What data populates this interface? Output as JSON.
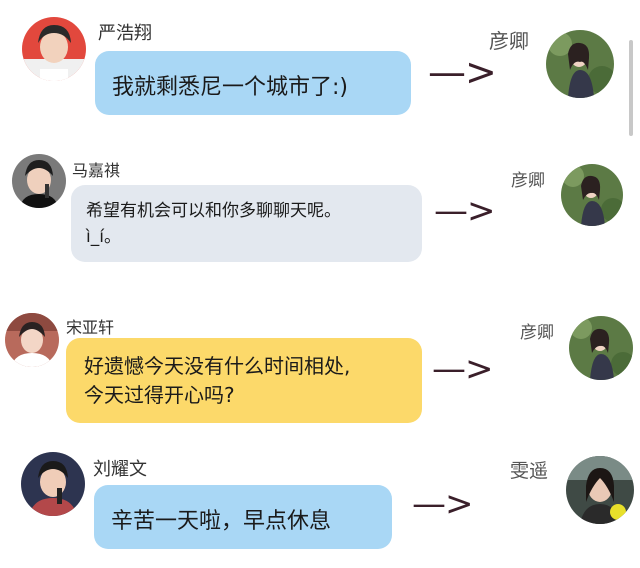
{
  "messages": [
    {
      "sender": "严浩翔",
      "text_lines": [
        "我就剩悉尼一个城市了:)"
      ],
      "bubble_color": "#a9d7f5",
      "arrow": "—>",
      "recipient": "彦卿"
    },
    {
      "sender": "马嘉祺",
      "text_lines": [
        "希望有机会可以和你多聊聊天呢。",
        "ì_í。"
      ],
      "bubble_color": "#e3e8ef",
      "arrow": "—>",
      "recipient": "彦卿"
    },
    {
      "sender": "宋亚轩",
      "text_lines": [
        "好遗憾今天没有什么时间相处,",
        "今天过得开心吗?"
      ],
      "bubble_color": "#fcd96a",
      "arrow": "—>",
      "recipient": "彦卿"
    },
    {
      "sender": "刘耀文",
      "text_lines": [
        "辛苦一天啦，早点休息"
      ],
      "bubble_color": "#a9d7f5",
      "arrow": "—>",
      "recipient": "雯遥"
    }
  ],
  "icons": {
    "sender_avatar": "person-avatar",
    "recipient_avatar": "person-avatar"
  }
}
